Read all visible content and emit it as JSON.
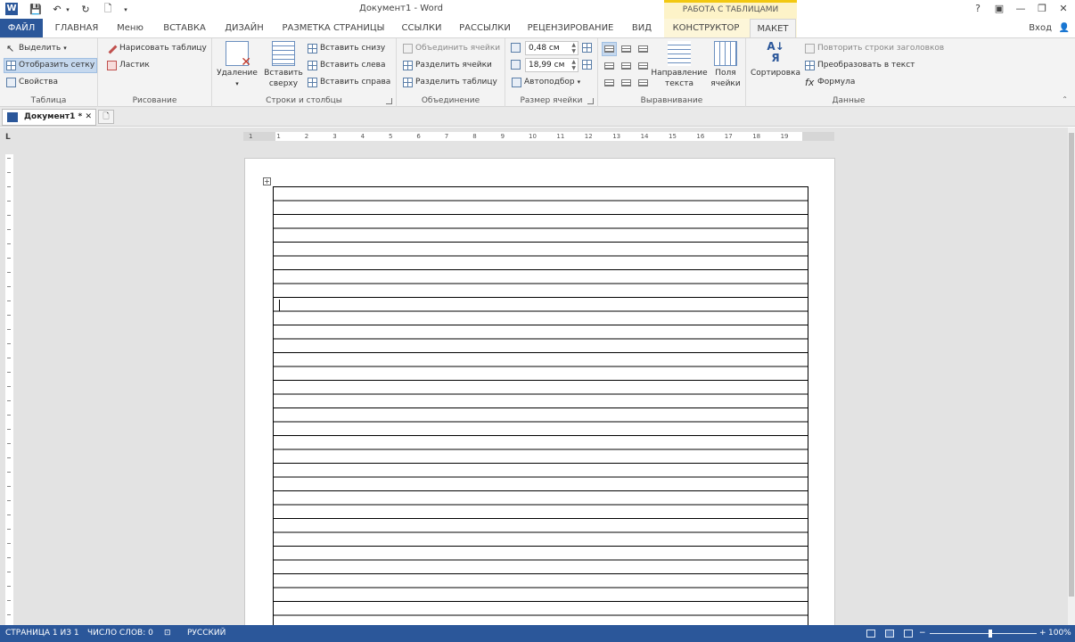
{
  "window": {
    "title": "Документ1 - Word",
    "context_group": "РАБОТА С ТАБЛИЦАМИ",
    "help": "?",
    "sign_in": "Вход",
    "app_logo": "W"
  },
  "tabs": [
    {
      "label": "ФАЙЛ"
    },
    {
      "label": "ГЛАВНАЯ"
    },
    {
      "label": "Меню"
    },
    {
      "label": "ВСТАВКА"
    },
    {
      "label": "ДИЗАЙН"
    },
    {
      "label": "РАЗМЕТКА СТРАНИЦЫ"
    },
    {
      "label": "ССЫЛКИ"
    },
    {
      "label": "РАССЫЛКИ"
    },
    {
      "label": "РЕЦЕНЗИРОВАНИЕ"
    },
    {
      "label": "ВИД"
    },
    {
      "label": "КОНСТРУКТОР"
    },
    {
      "label": "МАКЕТ"
    }
  ],
  "ribbon": {
    "table": {
      "label": "Таблица",
      "select": "Выделить",
      "show_grid": "Отобразить сетку",
      "properties": "Свойства"
    },
    "draw": {
      "label": "Рисование",
      "draw_table": "Нарисовать таблицу",
      "eraser": "Ластик"
    },
    "rows_cols": {
      "label": "Строки и столбцы",
      "delete": "Удаление",
      "insert_above_1": "Вставить",
      "insert_above_2": "сверху",
      "insert_below": "Вставить снизу",
      "insert_left": "Вставить слева",
      "insert_right": "Вставить справа"
    },
    "merge": {
      "label": "Объединение",
      "merge_cells": "Объединить ячейки",
      "split_cells": "Разделить ячейки",
      "split_table": "Разделить таблицу"
    },
    "cell_size": {
      "label": "Размер ячейки",
      "height": "0,48 см",
      "width": "18,99 см",
      "autofit": "Автоподбор"
    },
    "alignment": {
      "label": "Выравнивание",
      "text_dir_1": "Направление",
      "text_dir_2": "текста",
      "margins_1": "Поля",
      "margins_2": "ячейки"
    },
    "data": {
      "label": "Данные",
      "sort": "Сортировка",
      "repeat_header": "Повторить строки заголовков",
      "convert": "Преобразовать в текст",
      "formula": "Формула"
    }
  },
  "doc_tab": {
    "name": "Документ1 *",
    "close": "✕"
  },
  "ruler": {
    "corner": "L",
    "ticks": [
      "1",
      "1",
      "2",
      "3",
      "4",
      "5",
      "6",
      "7",
      "8",
      "9",
      "10",
      "11",
      "12",
      "13",
      "14",
      "15",
      "16",
      "17",
      "18",
      "19"
    ]
  },
  "status": {
    "page": "СТРАНИЦА 1 ИЗ 1",
    "words": "ЧИСЛО СЛОВ: 0",
    "language": "РУССКИЙ",
    "zoom": "100%",
    "zoom_minus": "−",
    "zoom_plus": "+"
  }
}
